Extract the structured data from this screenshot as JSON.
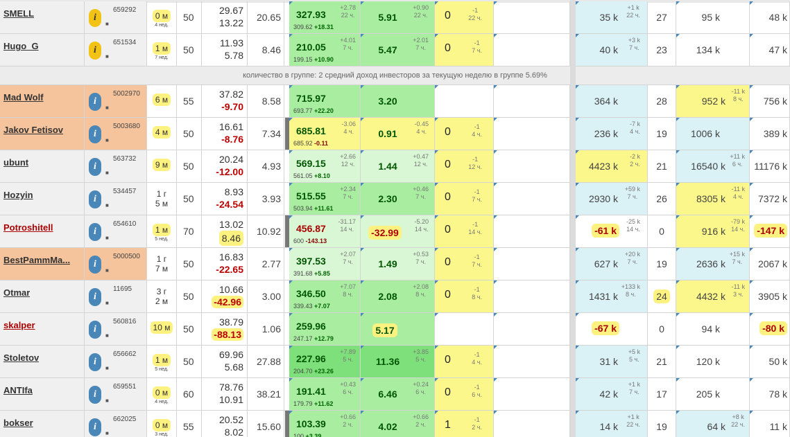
{
  "group_summary": "количество в группе: 2    средний доход инвесторов за текущую неделю в группе 5.69%",
  "rows_top": [
    {
      "name": "SMELL",
      "acct": "659292",
      "info": "yellow",
      "age": "0 м",
      "age_sub": "4 нед.",
      "lev": "50",
      "a": "29.67",
      "b": "13.22",
      "b_neg": false,
      "c": "20.65",
      "profit": "327.93",
      "pd": "+2.78",
      "pd2": "22 ч.",
      "psub": "309.62",
      "psubv": "+18.31",
      "p2": "5.91",
      "p2d": "+0.90",
      "p2d2": "22 ч.",
      "z": "0",
      "zd": "-1",
      "zd2": "22 ч.",
      "k1": "35 k",
      "k1d": "+1 k",
      "k1d2": "22 ч.",
      "n": "27",
      "k2": "95 k",
      "k3": "48 k"
    },
    {
      "name": "Hugo_G",
      "acct": "651534",
      "info": "yellow",
      "age": "1 м",
      "age_sub": "7 нед.",
      "lev": "50",
      "a": "11.93",
      "b": "5.78",
      "b_neg": false,
      "c": "8.46",
      "profit": "210.05",
      "pd": "+4.01",
      "pd2": "7 ч.",
      "psub": "199.15",
      "psubv": "+10.90",
      "p2": "5.47",
      "p2d": "+2.01",
      "p2d2": "7 ч.",
      "z": "0",
      "zd": "-1",
      "zd2": "7 ч.",
      "k1": "40 k",
      "k1d": "+3 k",
      "k1d2": "7 ч.",
      "n": "23",
      "k2": "134 k",
      "k3": "47 k"
    }
  ],
  "rows": [
    {
      "name": "Mad Wolf",
      "acct": "5002970",
      "orange": true,
      "age": "6 м",
      "age_sub": "",
      "lev": "55",
      "a": "37.82",
      "b": "-9.70",
      "b_neg": true,
      "c": "8.58",
      "profit": "715.97",
      "pd": "",
      "pd2": "",
      "psub": "693.77",
      "psubv": "+22.20",
      "p2": "3.20",
      "p2d": "",
      "p2d2": "",
      "z": "",
      "zd": "",
      "zd2": "",
      "k1": "364 k",
      "k1d": "",
      "k1d2": "",
      "n": "28",
      "k2": "952 k",
      "k2d": "-11 k",
      "k2d2": "8 ч.",
      "k3": "756 k"
    },
    {
      "name": "Jakov Fetisov",
      "acct": "5003680",
      "orange": true,
      "age": "4 м",
      "age_sub": "",
      "lev": "50",
      "a": "16.61",
      "b": "-8.76",
      "b_neg": true,
      "c": "7.34",
      "profit": "685.81",
      "pd": "-3.06",
      "pd2": "4 ч.",
      "psub": "685.92",
      "psubv": "-0.11",
      "p2": "0.91",
      "p2d": "-0.45",
      "p2d2": "4 ч.",
      "z": "0",
      "zd": "-1",
      "zd2": "4 ч.",
      "k1": "236 k",
      "k1d": "-7 k",
      "k1d2": "4 ч.",
      "n": "19",
      "k2": "1006 k",
      "k2d": "",
      "k2d2": "",
      "k3": "389 k"
    },
    {
      "name": "ubunt",
      "acct": "563732",
      "age": "9 м",
      "age_sub": "",
      "lev": "50",
      "a": "20.24",
      "b": "-12.00",
      "b_neg": true,
      "c": "4.93",
      "profit": "569.15",
      "pd": "+2.66",
      "pd2": "12 ч.",
      "psub": "561.05",
      "psubv": "+8.10",
      "p2": "1.44",
      "p2d": "+0.47",
      "p2d2": "12 ч.",
      "z": "0",
      "zd": "-1",
      "zd2": "12 ч.",
      "k1": "4423 k",
      "k1d": "-2 k",
      "k1d2": "2 ч.",
      "n": "21",
      "k2": "16540 k",
      "k2d": "+11 k",
      "k2d2": "6 ч.",
      "k3": "11176 k"
    },
    {
      "name": "Hozyin",
      "acct": "534457",
      "age": "1 г",
      "age2": "5 м",
      "lev": "50",
      "a": "8.93",
      "b": "-24.54",
      "b_neg": true,
      "c": "3.93",
      "profit": "515.55",
      "pd": "+2.34",
      "pd2": "7 ч.",
      "psub": "503.94",
      "psubv": "+11.61",
      "p2": "2.30",
      "p2d": "+0.46",
      "p2d2": "7 ч.",
      "z": "0",
      "zd": "-1",
      "zd2": "7 ч.",
      "k1": "2930 k",
      "k1d": "+59 k",
      "k1d2": "7 ч.",
      "n": "26",
      "k2": "8305 k",
      "k2d": "-11 k",
      "k2d2": "4 ч.",
      "k3": "7372 k"
    },
    {
      "name": "Potroshitell",
      "acct": "654610",
      "red": true,
      "age": "1 м",
      "age_sub": "5 нед.",
      "lev": "70",
      "a": "13.02",
      "b": "8.46",
      "b_neg": false,
      "c": "10.92",
      "profit": "456.87",
      "pd": "-31.17",
      "pd2": "14 ч.",
      "psub": "600",
      "psubv": "-143.13",
      "p2": "-32.99",
      "p2d": "-5.20",
      "p2d2": "14 ч.",
      "z": "0",
      "zd": "-1",
      "zd2": "14 ч.",
      "k1": "-61 k",
      "k1d": "-25 k",
      "k1d2": "14 ч.",
      "n": "0",
      "k2": "916 k",
      "k2d": "-79 k",
      "k2d2": "14 ч.",
      "k3": "-147 k"
    },
    {
      "name": "BestPammMa...",
      "acct": "5000500",
      "orange": true,
      "age": "1 г",
      "age2": "7 м",
      "lev": "50",
      "a": "16.83",
      "b": "-22.65",
      "b_neg": true,
      "c": "2.77",
      "profit": "397.53",
      "pd": "+2.07",
      "pd2": "7 ч.",
      "psub": "391.68",
      "psubv": "+5.85",
      "p2": "1.49",
      "p2d": "+0.53",
      "p2d2": "7 ч.",
      "z": "0",
      "zd": "-1",
      "zd2": "7 ч.",
      "k1": "627 k",
      "k1d": "+20 k",
      "k1d2": "7 ч.",
      "n": "19",
      "k2": "2636 k",
      "k2d": "+15 k",
      "k2d2": "7 ч.",
      "k3": "2067 k"
    },
    {
      "name": "Otmar",
      "acct": "11695",
      "age": "3 г",
      "age2": "2 м",
      "lev": "50",
      "a": "10.66",
      "b": "-42.96",
      "b_neg": true,
      "c": "3.00",
      "profit": "346.50",
      "pd": "+7.07",
      "pd2": "8 ч.",
      "psub": "339.43",
      "psubv": "+7.07",
      "p2": "2.08",
      "p2d": "+2.08",
      "p2d2": "8 ч.",
      "z": "0",
      "zd": "-1",
      "zd2": "8 ч.",
      "k1": "1431 k",
      "k1d": "+133 k",
      "k1d2": "8 ч.",
      "n": "24",
      "k2": "4432 k",
      "k2d": "-11 k",
      "k2d2": "3 ч.",
      "k3": "3905 k"
    },
    {
      "name": "skalper",
      "acct": "560816",
      "red": true,
      "age": "10 м",
      "age_sub": "",
      "lev": "50",
      "a": "38.79",
      "b": "-88.13",
      "b_neg": true,
      "c": "1.06",
      "profit": "259.96",
      "pd": "",
      "pd2": "",
      "psub": "247.17",
      "psubv": "+12.79",
      "p2": "5.17",
      "p2d": "",
      "p2d2": "",
      "z": "",
      "zd": "",
      "zd2": "",
      "k1": "-67 k",
      "k1d": "",
      "k1d2": "",
      "n": "0",
      "k2": "94 k",
      "k2d": "",
      "k2d2": "",
      "k3": "-80 k"
    },
    {
      "name": "Stoletov",
      "acct": "656662",
      "age": "1 м",
      "age_sub": "5 нед.",
      "lev": "50",
      "a": "69.96",
      "b": "5.68",
      "b_neg": false,
      "c": "27.88",
      "profit": "227.96",
      "pd": "+7.89",
      "pd2": "5 ч.",
      "psub": "204.70",
      "psubv": "+23.26",
      "p2": "11.36",
      "p2d": "+3.85",
      "p2d2": "5 ч.",
      "z": "0",
      "zd": "-1",
      "zd2": "4 ч.",
      "k1": "31 k",
      "k1d": "+5 k",
      "k1d2": "5 ч.",
      "n": "21",
      "k2": "120 k",
      "k2d": "",
      "k2d2": "",
      "k3": "50 k"
    },
    {
      "name": "ANTIfa",
      "acct": "659551",
      "age": "0 м",
      "age_sub": "4 нед.",
      "lev": "60",
      "a": "78.76",
      "b": "10.91",
      "b_neg": false,
      "c": "38.21",
      "profit": "191.41",
      "pd": "+0.43",
      "pd2": "6 ч.",
      "psub": "179.79",
      "psubv": "+11.62",
      "p2": "6.46",
      "p2d": "+0.24",
      "p2d2": "6 ч.",
      "z": "0",
      "zd": "-1",
      "zd2": "6 ч.",
      "k1": "42 k",
      "k1d": "+1 k",
      "k1d2": "7 ч.",
      "n": "17",
      "k2": "205 k",
      "k2d": "",
      "k2d2": "",
      "k3": "78 k"
    },
    {
      "name": "bokser",
      "acct": "662025",
      "age": "0 м",
      "age_sub": "3 нед.",
      "lev": "55",
      "a": "20.52",
      "b": "8.02",
      "b_neg": false,
      "c": "15.60",
      "profit": "103.39",
      "pd": "+0.66",
      "pd2": "2 ч.",
      "psub": "100",
      "psubv": "+3.39",
      "p2": "4.02",
      "p2d": "+0.66",
      "p2d2": "2 ч.",
      "z": "1",
      "zd": "-1",
      "zd2": "2 ч.",
      "k1": "14 k",
      "k1d": "+1 k",
      "k1d2": "22 ч.",
      "n": "19",
      "k2": "64 k",
      "k2d": "+8 k",
      "k2d2": "22 ч.",
      "k3": "11 k"
    }
  ],
  "info_glyph": "i",
  "dots_glyph": "■"
}
